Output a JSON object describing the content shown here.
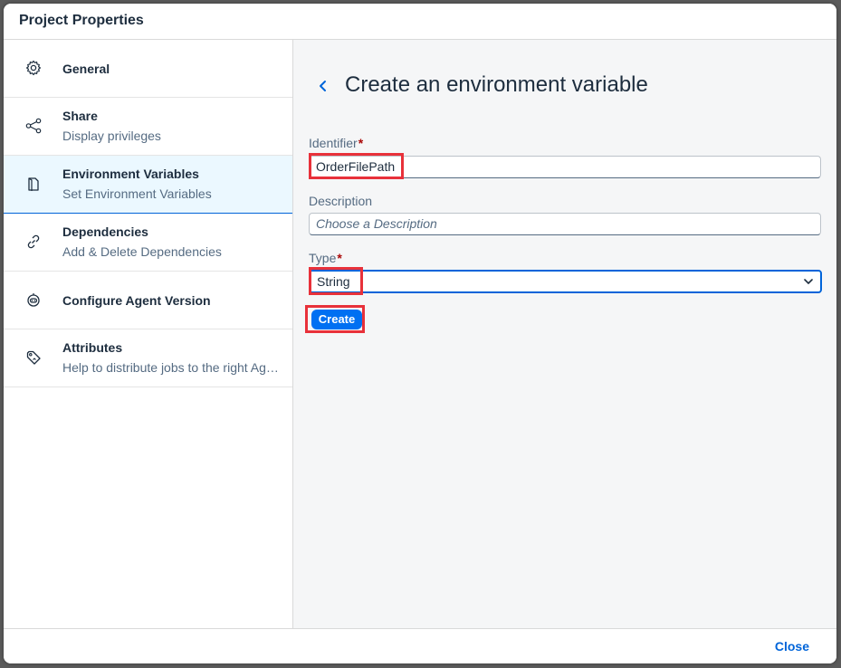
{
  "dialog": {
    "title": "Project Properties",
    "close_label": "Close"
  },
  "sidebar": {
    "items": [
      {
        "title": "General",
        "subtitle": "",
        "icon": "gear-icon"
      },
      {
        "title": "Share",
        "subtitle": "Display privileges",
        "icon": "share-icon"
      },
      {
        "title": "Environment Variables",
        "subtitle": "Set Environment Variables",
        "icon": "document-icon",
        "active": true
      },
      {
        "title": "Dependencies",
        "subtitle": "Add & Delete Dependencies",
        "icon": "link-icon"
      },
      {
        "title": "Configure Agent Version",
        "subtitle": "",
        "icon": "robot-icon"
      },
      {
        "title": "Attributes",
        "subtitle": "Help to distribute jobs to the right Agents",
        "icon": "tag-icon"
      }
    ]
  },
  "form": {
    "title": "Create an environment variable",
    "identifier_label": "Identifier",
    "identifier_value": "OrderFilePath",
    "description_label": "Description",
    "description_placeholder": "Choose a Description",
    "type_label": "Type",
    "type_value": "String",
    "required_marker": "*",
    "create_label": "Create"
  },
  "colors": {
    "accent": "#0064d9",
    "button": "#0070f2",
    "highlight": "#e8313a",
    "required": "#aa0808"
  }
}
